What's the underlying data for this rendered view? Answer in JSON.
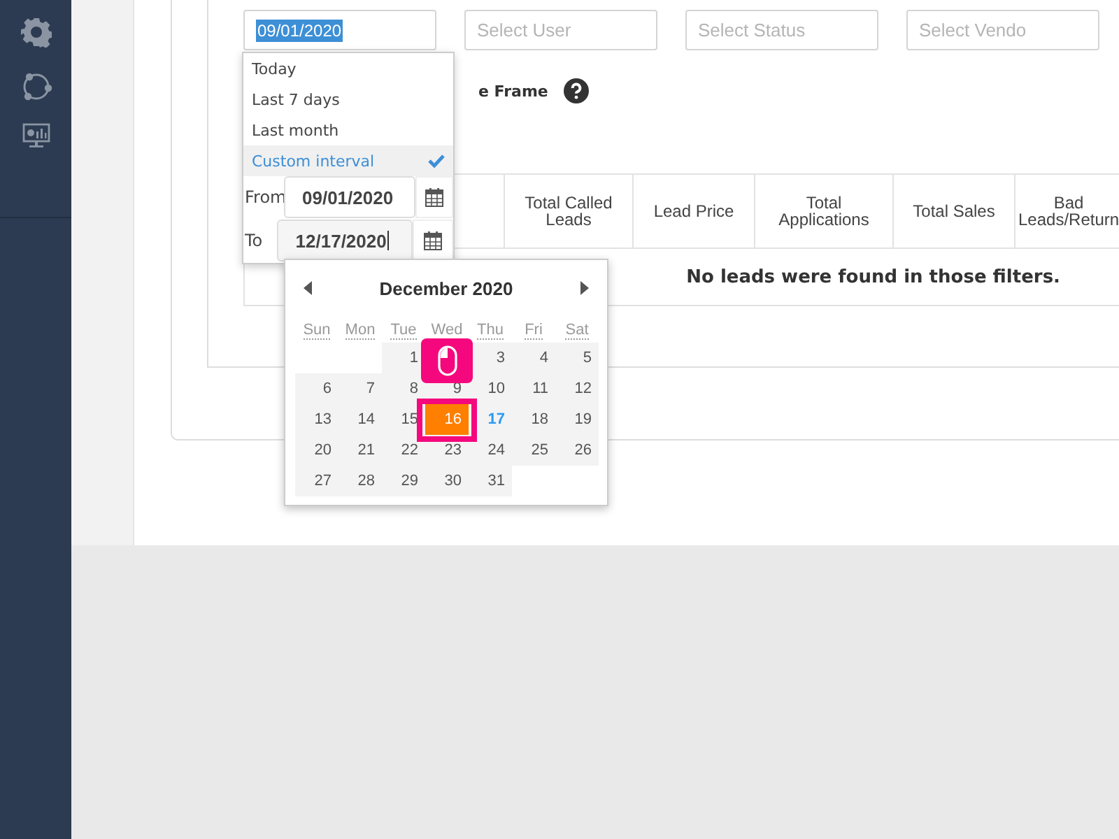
{
  "sidebar": {
    "items": [
      {
        "kind": "gear"
      },
      {
        "kind": "nodes"
      },
      {
        "kind": "monitor"
      }
    ]
  },
  "filters": [
    {
      "kind": "date",
      "value": "09/01/2020",
      "text_selected": true
    },
    {
      "kind": "select",
      "placeholder": "Select User"
    },
    {
      "kind": "select",
      "placeholder": "Select Status"
    },
    {
      "kind": "select",
      "placeholder": "Select Vendo"
    }
  ],
  "time_frame_label": "e Frame",
  "range_menu": {
    "options": [
      {
        "label": "Today",
        "selected": false
      },
      {
        "label": "Last 7 days",
        "selected": false
      },
      {
        "label": "Last month",
        "selected": false
      },
      {
        "label": "Custom interval",
        "selected": true
      }
    ],
    "from": {
      "label": "From",
      "value": "09/01/2020",
      "focused": false
    },
    "to": {
      "label": "To",
      "value": "12/17/2020",
      "focused": true
    }
  },
  "table": {
    "columns": [
      "",
      "Total Called Leads",
      "Lead Price",
      "Total Applications",
      "Total Sales",
      "Bad Leads/Return"
    ],
    "empty_message": "No leads were found in those filters."
  },
  "calendar": {
    "title": "December 2020",
    "weekdays": [
      "Sun",
      "Mon",
      "Tue",
      "Wed",
      "Thu",
      "Fri",
      "Sat"
    ],
    "weeks": [
      [
        {
          "kind": "empty"
        },
        {
          "kind": "empty"
        },
        {
          "kind": "day",
          "day": "1",
          "selected": false,
          "today": false
        },
        {
          "kind": "covered"
        },
        {
          "kind": "day",
          "day": "3",
          "selected": false,
          "today": false
        },
        {
          "kind": "day",
          "day": "4",
          "selected": false,
          "today": false
        },
        {
          "kind": "day",
          "day": "5",
          "selected": false,
          "today": false
        }
      ],
      [
        {
          "kind": "day",
          "day": "6",
          "selected": false,
          "today": false
        },
        {
          "kind": "day",
          "day": "7",
          "selected": false,
          "today": false
        },
        {
          "kind": "day",
          "day": "8",
          "selected": false,
          "today": false
        },
        {
          "kind": "day",
          "day": "9",
          "selected": false,
          "today": false
        },
        {
          "kind": "day",
          "day": "10",
          "selected": false,
          "today": false
        },
        {
          "kind": "day",
          "day": "11",
          "selected": false,
          "today": false
        },
        {
          "kind": "day",
          "day": "12",
          "selected": false,
          "today": false
        }
      ],
      [
        {
          "kind": "day",
          "day": "13",
          "selected": false,
          "today": false
        },
        {
          "kind": "day",
          "day": "14",
          "selected": false,
          "today": false
        },
        {
          "kind": "day",
          "day": "15",
          "selected": false,
          "today": false
        },
        {
          "kind": "day",
          "day": "16",
          "selected": true,
          "today": false
        },
        {
          "kind": "day",
          "day": "17",
          "selected": false,
          "today": true
        },
        {
          "kind": "day",
          "day": "18",
          "selected": false,
          "today": false
        },
        {
          "kind": "day",
          "day": "19",
          "selected": false,
          "today": false
        }
      ],
      [
        {
          "kind": "day",
          "day": "20",
          "selected": false,
          "today": false
        },
        {
          "kind": "day",
          "day": "21",
          "selected": false,
          "today": false
        },
        {
          "kind": "day",
          "day": "22",
          "selected": false,
          "today": false
        },
        {
          "kind": "day",
          "day": "23",
          "selected": false,
          "today": false
        },
        {
          "kind": "day",
          "day": "24",
          "selected": false,
          "today": false
        },
        {
          "kind": "day",
          "day": "25",
          "selected": false,
          "today": false
        },
        {
          "kind": "day",
          "day": "26",
          "selected": false,
          "today": false
        }
      ],
      [
        {
          "kind": "day",
          "day": "27",
          "selected": false,
          "today": false
        },
        {
          "kind": "day",
          "day": "28",
          "selected": false,
          "today": false
        },
        {
          "kind": "day",
          "day": "29",
          "selected": false,
          "today": false
        },
        {
          "kind": "day",
          "day": "30",
          "selected": false,
          "today": false
        },
        {
          "kind": "day",
          "day": "31",
          "selected": false,
          "today": false
        },
        {
          "kind": "empty"
        },
        {
          "kind": "empty"
        }
      ]
    ]
  },
  "click_marker": {
    "shown": true
  }
}
